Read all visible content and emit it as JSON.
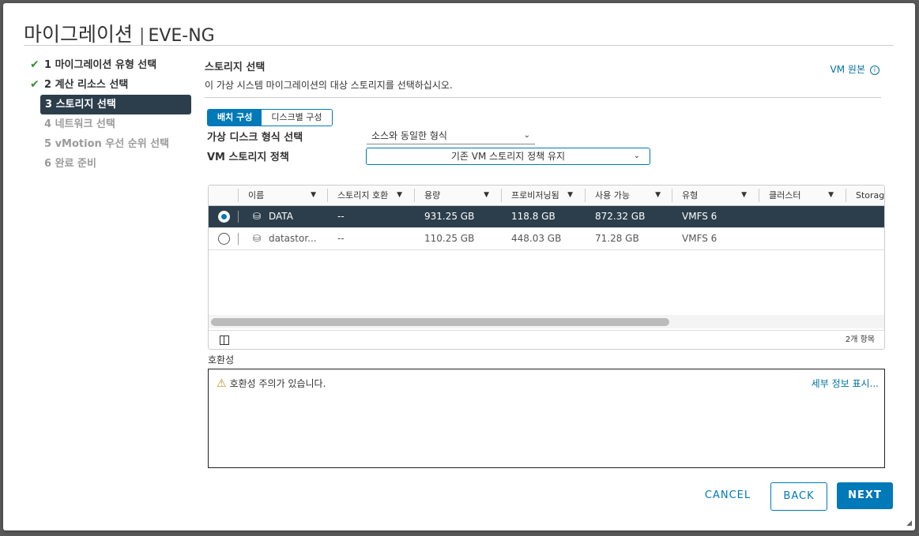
{
  "dialog": {
    "title": "마이그레이션",
    "separator": "|",
    "vm_name": "EVE-NG"
  },
  "steps": [
    {
      "label": "1 마이그레이션 유형 선택",
      "state": "done"
    },
    {
      "label": "2 계산 리소스 선택",
      "state": "done"
    },
    {
      "label": "3 스토리지 선택",
      "state": "active"
    },
    {
      "label": "4 네트워크 선택",
      "state": "future"
    },
    {
      "label": "5 vMotion 우선 순위 선택",
      "state": "future"
    },
    {
      "label": "6 완료 준비",
      "state": "future"
    }
  ],
  "content": {
    "title": "스토리지 선택",
    "subtitle": "이 가상 시스템 마이그레이션의 대상 스토리지를 선택하십시오.",
    "vm_origin": "VM 원본",
    "seg_batch": "배치 구성",
    "seg_disk": "디스크별 구성",
    "disk_format_label": "가상 디스크 형식 선택",
    "disk_format_value": "소스와 동일한 형식",
    "policy_label": "VM 스토리지 정책",
    "policy_value": "기존 VM 스토리지 정책 유지"
  },
  "table": {
    "columns": [
      "이름",
      "스토리지 호환",
      "용량",
      "프로비저닝됨",
      "사용 가능",
      "유형",
      "클러스터",
      "Storag"
    ],
    "rows": [
      {
        "name": "DATA",
        "compat": "--",
        "capacity": "931.25 GB",
        "provisioned": "118.8 GB",
        "free": "872.32 GB",
        "type": "VMFS 6",
        "cluster": ""
      },
      {
        "name": "datastor...",
        "compat": "--",
        "capacity": "110.25 GB",
        "provisioned": "448.03 GB",
        "free": "71.28 GB",
        "type": "VMFS 6",
        "cluster": ""
      }
    ],
    "item_count": "2개 항목"
  },
  "compatibility": {
    "label": "호환성",
    "warning": "호환성 주의가 있습니다.",
    "details_link": "세부 정보 표시..."
  },
  "buttons": {
    "cancel": "CANCEL",
    "back": "BACK",
    "next": "NEXT"
  },
  "colors": {
    "accent": "#0079b8",
    "selected_row": "#2c3e4c",
    "check": "#3b8f3b",
    "warning": "#c7931c"
  }
}
